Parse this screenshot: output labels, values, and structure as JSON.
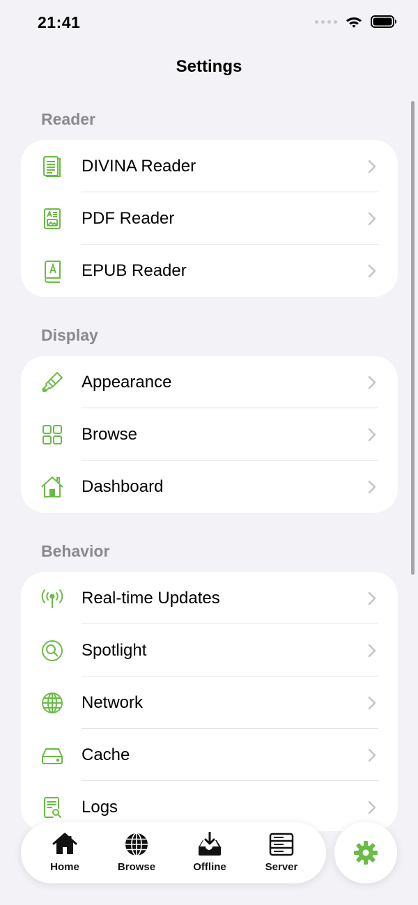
{
  "status": {
    "time": "21:41"
  },
  "nav": {
    "title": "Settings"
  },
  "accent_color": "#6abb46",
  "sections": [
    {
      "header": "Reader",
      "items": [
        {
          "label": "DIVINA Reader",
          "icon": "document-text-icon"
        },
        {
          "label": "PDF Reader",
          "icon": "pdf-document-icon"
        },
        {
          "label": "EPUB Reader",
          "icon": "book-icon"
        }
      ]
    },
    {
      "header": "Display",
      "items": [
        {
          "label": "Appearance",
          "icon": "paintbrush-icon"
        },
        {
          "label": "Browse",
          "icon": "grid-icon"
        },
        {
          "label": "Dashboard",
          "icon": "house-icon"
        }
      ]
    },
    {
      "header": "Behavior",
      "items": [
        {
          "label": "Real-time Updates",
          "icon": "antenna-icon"
        },
        {
          "label": "Spotlight",
          "icon": "magnifier-icon"
        },
        {
          "label": "Network",
          "icon": "globe-icon"
        },
        {
          "label": "Cache",
          "icon": "drive-icon"
        },
        {
          "label": "Logs",
          "icon": "doc-search-icon"
        }
      ]
    }
  ],
  "tabbar": {
    "tabs": [
      {
        "label": "Home",
        "icon": "house-fill-icon"
      },
      {
        "label": "Browse",
        "icon": "globe-icon"
      },
      {
        "label": "Offline",
        "icon": "tray-download-icon"
      },
      {
        "label": "Server",
        "icon": "server-rack-icon"
      }
    ],
    "settings_icon": "gear-icon"
  }
}
